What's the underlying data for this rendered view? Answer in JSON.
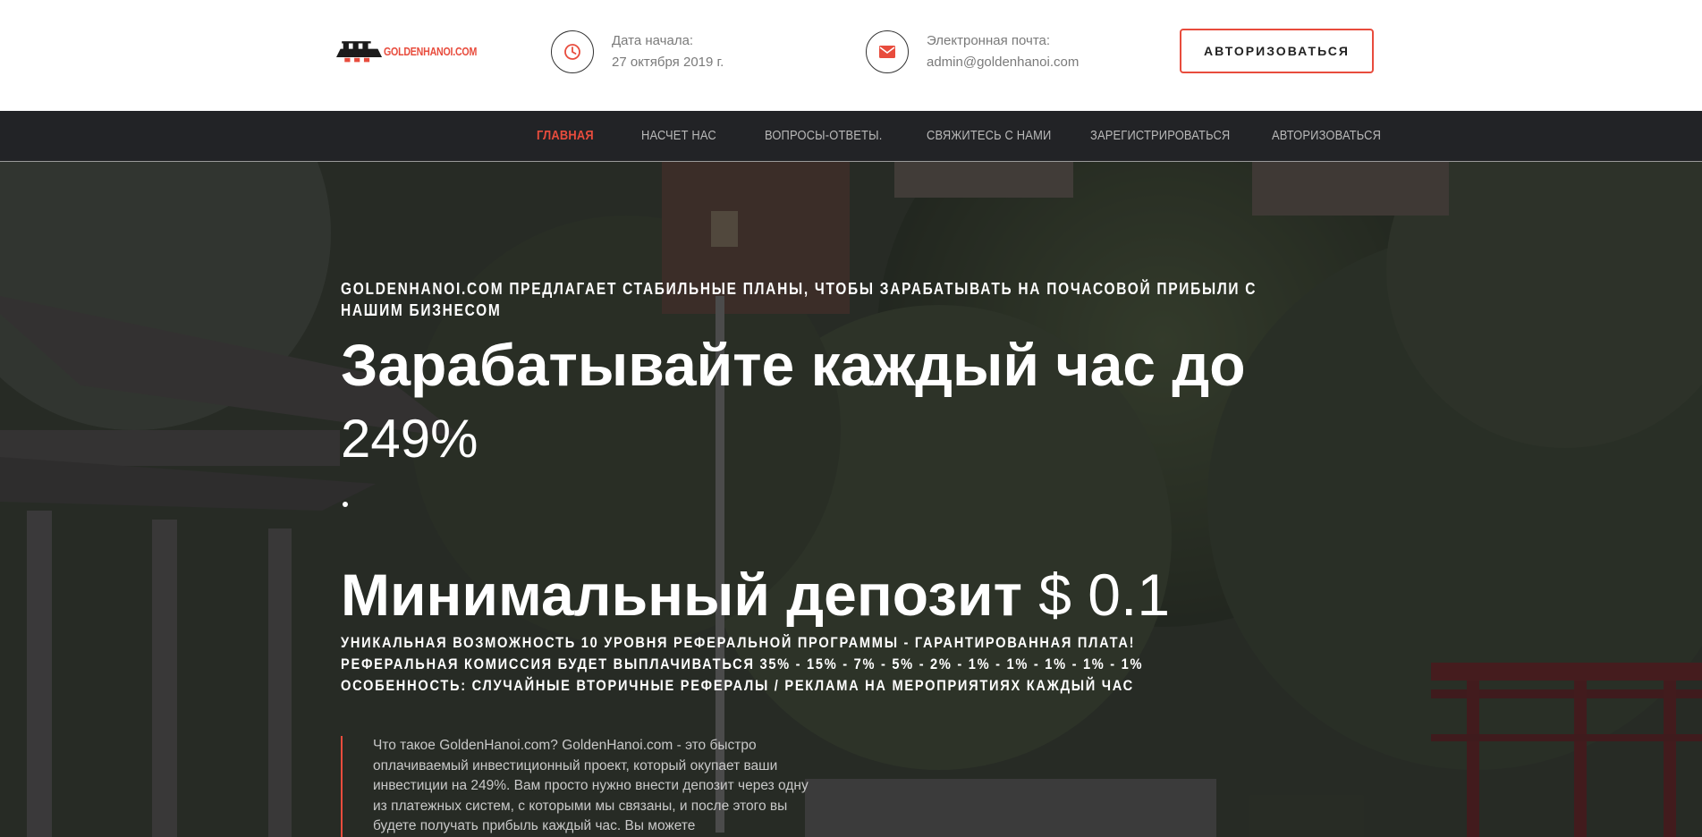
{
  "header": {
    "logo_text": "GOLDENHANOI.COM",
    "start_date_label": "Дата начала:",
    "start_date_value": "27 октября 2019 г.",
    "email_label": "Электронная почта:",
    "email_value": "admin@goldenhanoi.com",
    "login_button": "АВТОРИЗОВАТЬСЯ"
  },
  "nav": {
    "items": [
      {
        "label": "ГЛАВНАЯ"
      },
      {
        "label": "НАСЧЕТ НАС"
      },
      {
        "label": "ВОПРОСЫ-ОТВЕТЫ."
      },
      {
        "label": "СВЯЖИТЕСЬ С НАМИ"
      },
      {
        "label": "ЗАРЕГИСТРИРОВАТЬСЯ"
      },
      {
        "label": "АВТОРИЗОВАТЬСЯ"
      }
    ]
  },
  "hero": {
    "kicker": "GOLDENHANOI.COM ПРЕДЛАГАЕТ СТАБИЛЬНЫЕ ПЛАНЫ, ЧТОБЫ ЗАРАБАТЫВАТЬ НА ПОЧАСОВОЙ ПРИБЫЛИ С НАШИМ БИЗНЕСОМ",
    "headline": "Зарабатывайте каждый час до",
    "headline_percent": "249%",
    "deposit_label": "Минимальный депозит",
    "deposit_amount": "$ 0.1",
    "ref_line_1": "УНИКАЛЬНАЯ ВОЗМОЖНОСТЬ 10 УРОВНЯ РЕФЕРАЛЬНОЙ ПРОГРАММЫ - ГАРАНТИРОВАННАЯ ПЛАТА!",
    "ref_line_2": "РЕФЕРАЛЬНАЯ КОМИССИЯ БУДЕТ ВЫПЛАЧИВАТЬСЯ 35% - 15% - 7% - 5% - 2% - 1% - 1% - 1% - 1% - 1%",
    "ref_line_3": "ОСОБЕННОСТЬ: СЛУЧАЙНЫЕ ВТОРИЧНЫЕ РЕФЕРАЛЫ / РЕКЛАМА НА МЕРОПРИЯТИЯХ КАЖДЫЙ ЧАС",
    "description": "Что такое GoldenHanoi.com? GoldenHanoi.com - это быстро оплачиваемый инвестиционный проект, который окупает ваши инвестиции на 249%. Вам просто нужно внести депозит через одну из платежных систем, с которыми мы связаны, и после этого вы будете получать прибыль каждый час. Вы можете"
  },
  "colors": {
    "accent": "#e84c3d",
    "nav_bg": "#222326",
    "text_muted": "#7a7a7a"
  },
  "icons": {
    "date": "clock-icon",
    "email": "envelope-icon"
  }
}
